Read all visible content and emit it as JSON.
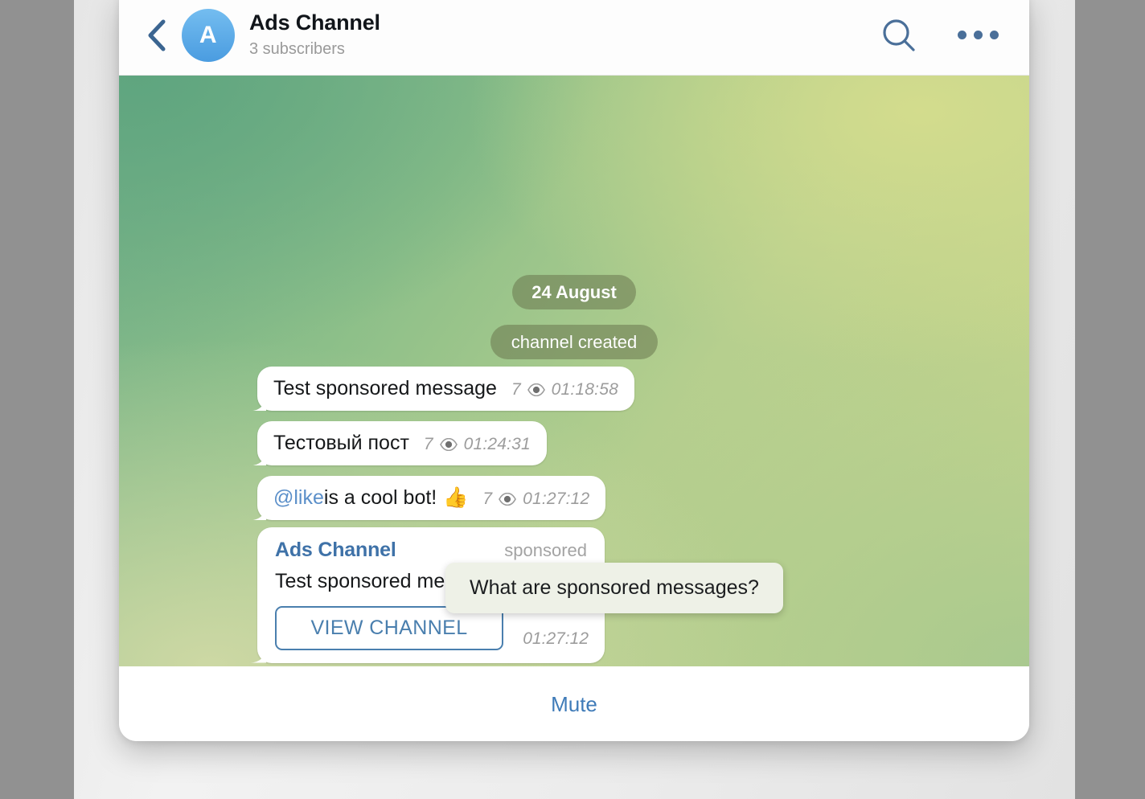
{
  "header": {
    "back_icon": "chevron-left-icon",
    "avatar_letter": "A",
    "title": "Ads Channel",
    "subtitle": "3 subscribers",
    "search_icon": "search-icon",
    "more_icon": "more-options-icon"
  },
  "chat": {
    "date_pill": "24 August",
    "service_message": "channel created",
    "messages": [
      {
        "text": "Test sponsored message",
        "views": "7",
        "views_icon": "eye-icon",
        "time": "01:18:58"
      },
      {
        "text": "Тестовый пост",
        "views": "7",
        "views_icon": "eye-icon",
        "time": "01:24:31"
      },
      {
        "link": "@like",
        "text": " is a cool bot!",
        "emoji": "👍",
        "views": "7",
        "views_icon": "eye-icon",
        "time": "01:27:12"
      }
    ],
    "sponsored": {
      "channel_name": "Ads Channel",
      "label": "sponsored",
      "body": "Test sponsored message",
      "button": "VIEW CHANNEL",
      "time": "01:27:12"
    },
    "tooltip": "What are sponsored messages?"
  },
  "bottom": {
    "mute_label": "Mute"
  },
  "colors": {
    "accent_blue": "#3f7bb8",
    "link_blue": "#5b8fc9",
    "header_icon": "#4a6f99",
    "meta_gray": "#9c9c9c",
    "bg_green_start": "#74b088",
    "bg_green_end": "#cbd78b",
    "tooltip_bg": "#eef1e7"
  }
}
